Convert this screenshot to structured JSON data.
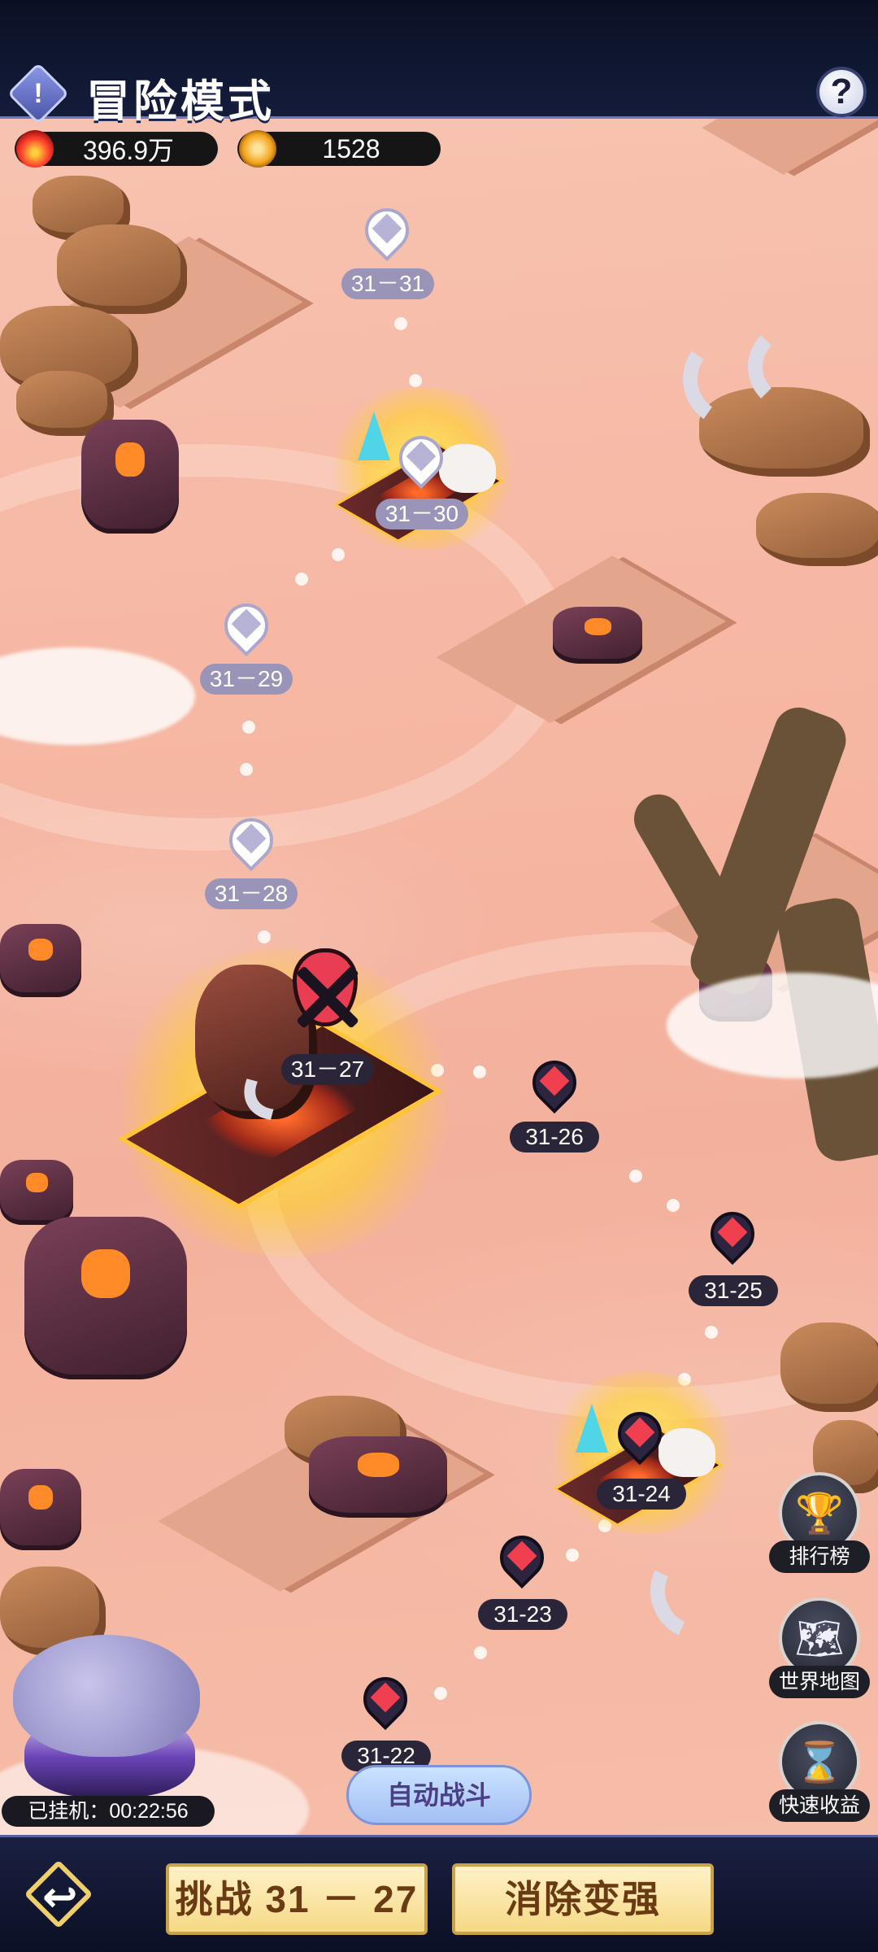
{
  "header": {
    "title": "冒险模式",
    "info_icon": "info-diamond-icon",
    "help_icon": "question-icon",
    "help_glyph": "?"
  },
  "resources": {
    "power": {
      "icon": "flame-icon",
      "value": "396.9万"
    },
    "gems": {
      "icon": "star-gem-icon",
      "value": "1528"
    }
  },
  "levels": {
    "l31": "31－31",
    "l30": "31－30",
    "l29": "31－29",
    "l28": "31－28",
    "l27": "31－27",
    "l26": "31-26",
    "l25": "31-25",
    "l24": "31-24",
    "l23": "31-23",
    "l22": "31-22"
  },
  "side_buttons": {
    "leaderboard": {
      "label": "排行榜",
      "icon": "trophy-icon"
    },
    "world_map": {
      "label": "世界地图",
      "icon": "world-map-icon"
    },
    "quick_income": {
      "label": "快速收益",
      "icon": "hourglass-icon"
    }
  },
  "auto_battle": {
    "label": "自动战斗"
  },
  "idle": {
    "text": "已挂机：00:22:56"
  },
  "bottom": {
    "back_icon": "return-arrow-icon",
    "challenge_label": "挑战 31 － 27",
    "strengthen_label": "消除变强"
  },
  "colors": {
    "map_background": "#f6b8a4",
    "locked_marker": "#b6b3d6",
    "open_marker": "#f04050",
    "button_gold": "#f6d986"
  }
}
